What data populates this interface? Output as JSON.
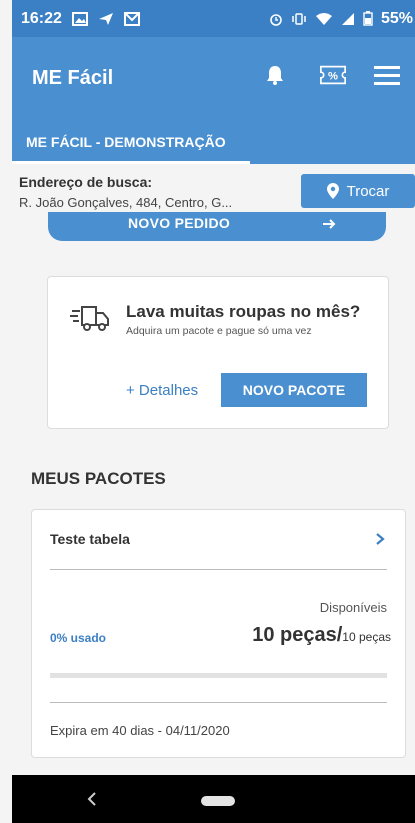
{
  "status_bar": {
    "time": "16:22",
    "battery_text": "55%"
  },
  "app_bar": {
    "title": "ME Fácil"
  },
  "tab": {
    "label": "ME FÁCIL - DEMONSTRAÇÃO"
  },
  "address": {
    "label": "Endereço de busca:",
    "value": "R. João Gonçalves, 484, Centro, G...",
    "swap_label": "Trocar"
  },
  "new_order": {
    "label": "NOVO PEDIDO"
  },
  "promo": {
    "title": "Lava muitas roupas no mês?",
    "subtitle": "Adquira um pacote e pague só uma vez",
    "details_label": "+ Detalhes",
    "new_package_label": "NOVO PACOTE"
  },
  "packages": {
    "section_title": "MEUS PACOTES",
    "items": [
      {
        "name": "Teste tabela",
        "available_label": "Disponíveis",
        "used_text": "0% usado",
        "used_fraction": 0,
        "count_big": "10 peças/",
        "count_small": "10 peças",
        "expiry": "Expira em 40 dias - 04/11/2020"
      }
    ]
  },
  "colors": {
    "primary": "#4a8fd0",
    "status_bar": "#3b7fc4",
    "link": "#3b7fc4"
  },
  "icons": {
    "status": [
      "image-icon",
      "send-icon",
      "mail-icon",
      "alarm-icon",
      "vibrate-icon",
      "wifi-icon",
      "signal-icon",
      "battery-icon"
    ],
    "app_bar": [
      "bell-icon",
      "coupon-percent-icon",
      "hamburger-menu-icon"
    ],
    "address": "location-pin-icon",
    "promo": "delivery-truck-icon"
  }
}
